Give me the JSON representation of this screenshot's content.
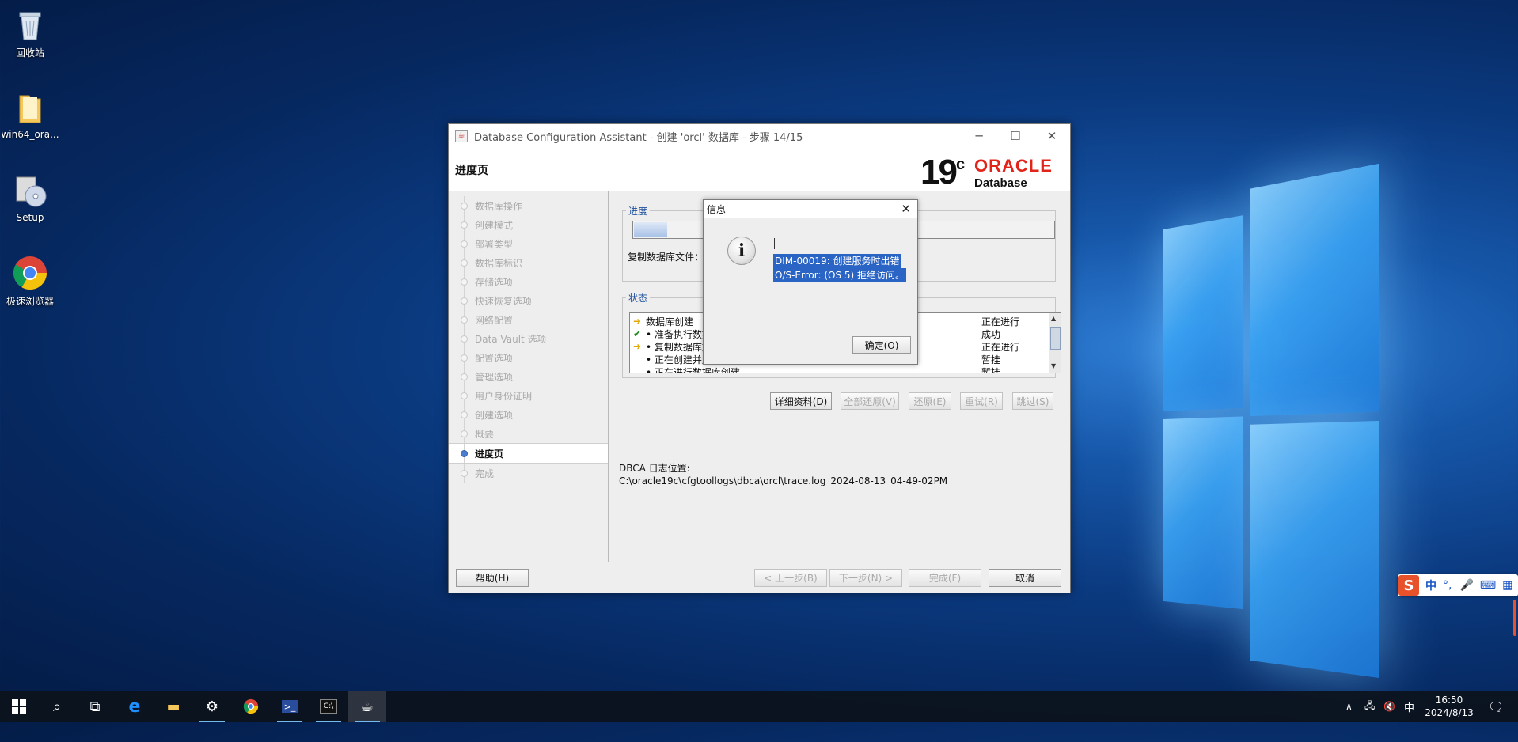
{
  "desktop": {
    "icons": [
      {
        "label": "回收站"
      },
      {
        "label": "win64_ora..."
      },
      {
        "label": "Setup"
      },
      {
        "label": "极速浏览器"
      }
    ]
  },
  "window": {
    "title": "Database Configuration Assistant - 创建 'orcl' 数据库 - 步骤 14/15",
    "page_title": "进度页",
    "brand": {
      "version": "19",
      "version_sup": "c",
      "vendor": "ORACLE",
      "product": "Database"
    },
    "steps": [
      {
        "label": "数据库操作"
      },
      {
        "label": "创建模式"
      },
      {
        "label": "部署类型"
      },
      {
        "label": "数据库标识"
      },
      {
        "label": "存储选项"
      },
      {
        "label": "快速恢复选项"
      },
      {
        "label": "网络配置"
      },
      {
        "label": "Data Vault 选项"
      },
      {
        "label": "配置选项"
      },
      {
        "label": "管理选项"
      },
      {
        "label": "用户身份证明"
      },
      {
        "label": "创建选项"
      },
      {
        "label": "概要"
      },
      {
        "label": "进度页"
      },
      {
        "label": "完成"
      }
    ],
    "active_step": "进度页",
    "progress": {
      "legend": "进度",
      "fraction": 0.08,
      "current_task": "复制数据库文件："
    },
    "status": {
      "legend": "状态",
      "rows": [
        {
          "icon": "arrow",
          "name": "数据库创建",
          "state": "正在进行"
        },
        {
          "icon": "check",
          "name": "• 准备执行数据库创建操作",
          "state": "成功"
        },
        {
          "icon": "arrow",
          "name": "• 复制数据库文件",
          "state": "正在进行"
        },
        {
          "icon": "none",
          "name": "• 正在创建并启动 Oracle 实例",
          "state": "暂挂"
        },
        {
          "icon": "none",
          "name": "• 正在进行数据库创建",
          "state": "暂挂"
        }
      ]
    },
    "action_buttons": {
      "details": "详细资料(D)",
      "revert_all": "全部还原(V)",
      "revert": "还原(E)",
      "retry": "重试(R)",
      "skip": "跳过(S)"
    },
    "log": {
      "label": "DBCA 日志位置:",
      "path": "C:\\oracle19c\\cfgtoollogs\\dbca\\orcl\\trace.log_2024-08-13_04-49-02PM"
    },
    "footer": {
      "help": "帮助(H)",
      "back": "< 上一步(B)",
      "next": "下一步(N) >",
      "finish": "完成(F)",
      "cancel": "取消"
    }
  },
  "dialog": {
    "title": "信息",
    "line1": "DIM-00019: 创建服务时出错",
    "line2": "O/S-Error: (OS 5) 拒绝访问。",
    "ok": "确定(O)"
  },
  "ime": {
    "lang": "中",
    "punct": "°,"
  },
  "tray": {
    "lang": "中",
    "time": "16:50",
    "date": "2024/8/13"
  },
  "colors": {
    "oracle_red": "#e2231a",
    "selection_blue": "#2a64c5",
    "legend_blue": "#1f4f9c"
  }
}
